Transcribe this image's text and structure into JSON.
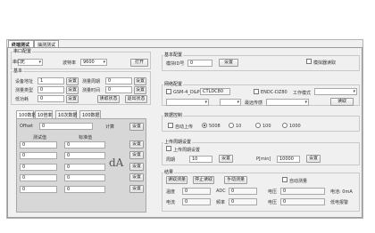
{
  "tabs": [
    "终端测试",
    "抽测测试"
  ],
  "port": {
    "legend": "串口配置",
    "port_label": "串口",
    "port_value": "无",
    "baud_label": "波特率",
    "baud_value": "9600",
    "open_button": "打开"
  },
  "device": {
    "legend": "基本",
    "rows": [
      {
        "label": "设备地址",
        "value": "1",
        "button": "设置",
        "label2": "测量周期",
        "value2": "0",
        "button2": "设置"
      },
      {
        "label": "测量类型",
        "value": "0",
        "button": "设置",
        "label2": "测量时间",
        "value2": "0",
        "button2": "设置"
      },
      {
        "label": "低功耗",
        "value": "0",
        "button": "设置"
      }
    ],
    "read_button": "读取状态",
    "exit_button": "退出状态"
  },
  "subtabs": [
    "100数据",
    "10倍率",
    "10次数据",
    "100数据"
  ],
  "calib": {
    "offset_label": "Offset",
    "offset_value": "0",
    "calc_label": "计算",
    "set_label": "设置",
    "col1": "测试值",
    "col2": "标准值",
    "rows": [
      {
        "a": "0",
        "b": "0",
        "btn": "设置"
      },
      {
        "a": "0",
        "b": "0",
        "btn": "设置"
      },
      {
        "a": "0",
        "b": "0",
        "btn": "设置"
      },
      {
        "a": "0",
        "b": "0",
        "btn": "设置"
      },
      {
        "a": "0",
        "b": "0",
        "btn": "设置"
      }
    ],
    "unit": "dA"
  },
  "right": {
    "basic": {
      "legend": "基本配置",
      "id_label": "模块ID号",
      "id_value": "0",
      "set": "设置",
      "check_label": "模拟器读取"
    },
    "net": {
      "legend": "网络配置",
      "opt1": "GSM-4_D&P",
      "addr": "CTLDC80",
      "opt2": "ENDC-DZ80",
      "mode_label": "工作模式",
      "mode2_label": "最远传感",
      "read": "读取"
    },
    "sleep": {
      "legend": "数据控制",
      "auto": "自动上传",
      "r1": "5008",
      "r2": "10",
      "r3": "100",
      "r4": "1000"
    },
    "upload": {
      "legend": "上传周期设置",
      "check": "上传周期设置",
      "p1_label": "周期",
      "p1_value": "10",
      "set": "设置",
      "p2_label": "P[min]",
      "p2_value": "10000",
      "set2": "设置"
    },
    "result": {
      "legend": "结果",
      "b1": "读取测量",
      "b2": "停止读取",
      "b3": "手动测量",
      "check": "自动测量",
      "rows": [
        {
          "l1": "温度",
          "v1": "0",
          "l2": "ADC",
          "v2": "0",
          "l3": "电压",
          "v3": "0",
          "l4": "电池: 0mA"
        },
        {
          "l1": "电流",
          "v1": "0",
          "l2": "频率",
          "v2": "0",
          "l3": "电压",
          "v3": "0",
          "l4": "低电报警"
        }
      ]
    }
  }
}
